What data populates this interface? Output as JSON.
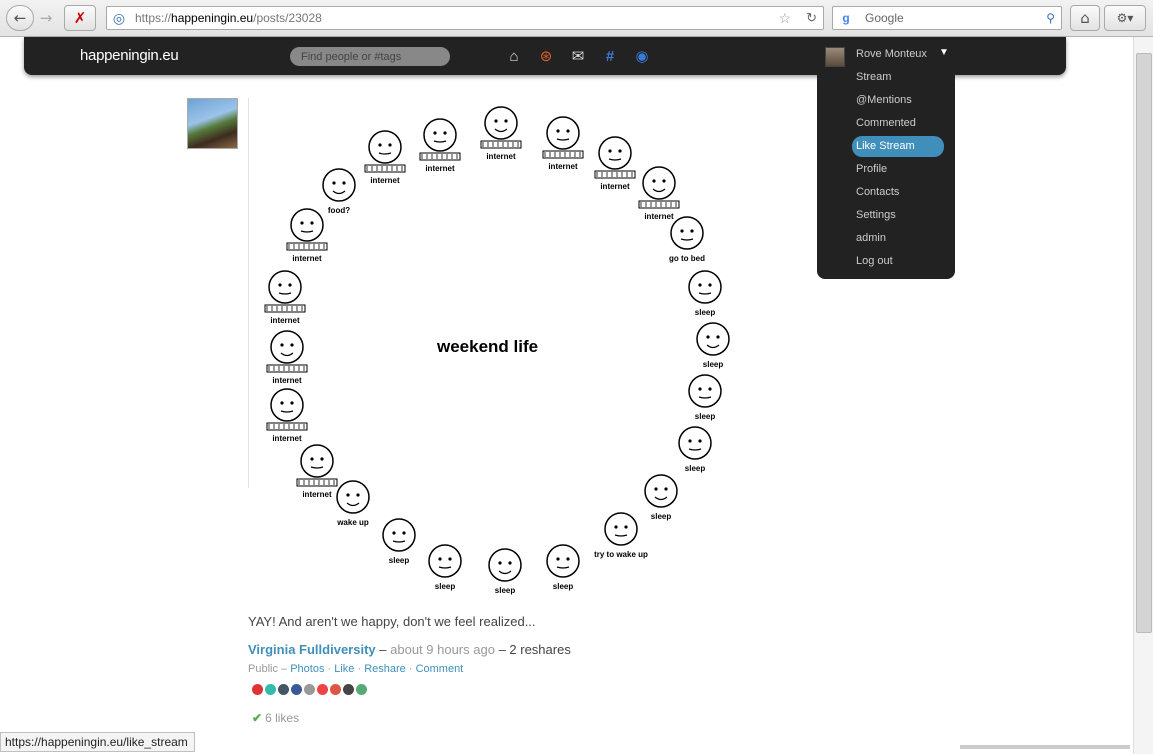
{
  "browser": {
    "url_prefix": "https://",
    "url_domain": "happeningin.eu",
    "url_path": "/posts/23028",
    "search_placeholder": "Google",
    "status_url": "https://happeningin.eu/like_stream"
  },
  "topbar": {
    "brand": "happeningin.eu",
    "search_placeholder": "Find people or #tags",
    "icons": [
      "home-icon",
      "notifications-icon",
      "messages-icon",
      "tags-icon",
      "aspects-icon"
    ]
  },
  "user_menu": {
    "name": "Rove Monteux",
    "items": [
      "Stream",
      "@Mentions",
      "Commented Posts",
      "Like Stream",
      "Profile",
      "Contacts",
      "Settings",
      "admin",
      "Log out"
    ],
    "active_index": 3
  },
  "post": {
    "image_title": "weekend life",
    "image_labels": [
      "food?",
      "internet",
      "go to bed",
      "sleep",
      "try to wake up",
      "wake up"
    ],
    "text": "YAY! And aren't we happy, don't we feel realized...",
    "author": "Virginia Fulldiversity",
    "dash": "–",
    "time": "about 9 hours ago",
    "reshares": "– 2 reshares",
    "visibility": "Public –",
    "actions": [
      "Photos",
      "Like",
      "Reshare",
      "Comment"
    ],
    "likes": "6 likes"
  },
  "colors": {
    "accent": "#3f8fba",
    "bar": "#222222"
  }
}
